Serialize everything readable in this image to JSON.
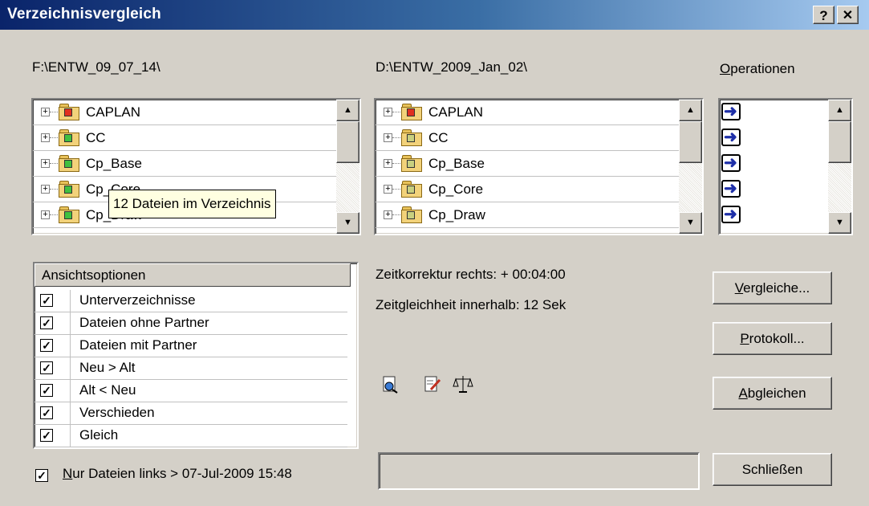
{
  "window": {
    "title": "Verzeichnisvergleich",
    "help_btn": "?",
    "close_btn": "✕"
  },
  "left": {
    "path": "F:\\ENTW_09_07_14\\",
    "items": [
      "CAPLAN",
      "CC",
      "Cp_Base",
      "Cp_Core",
      "Cp_Draw"
    ],
    "tooltip": "12 Dateien im Verzeichnis"
  },
  "right": {
    "path": "D:\\ENTW_2009_Jan_02\\",
    "items": [
      "CAPLAN",
      "CC",
      "Cp_Base",
      "Cp_Core",
      "Cp_Draw"
    ]
  },
  "operations": {
    "label": "Operationen",
    "label_accesskey": "O",
    "label_rest": "perationen",
    "count": 5
  },
  "view_options": {
    "header": "Ansichtsoptionen",
    "items": [
      {
        "label": "Unterverzeichnisse",
        "checked": true
      },
      {
        "label": "Dateien ohne Partner",
        "checked": true
      },
      {
        "label": "Dateien mit Partner",
        "checked": true
      },
      {
        "label": "Neu > Alt",
        "checked": true
      },
      {
        "label": "Alt < Neu",
        "checked": true
      },
      {
        "label": "Verschieden",
        "checked": true
      },
      {
        "label": "Gleich",
        "checked": true
      }
    ]
  },
  "filter": {
    "accesskey": "N",
    "label_rest": "ur Dateien links > 07-Jul-2009 15:48",
    "checked": true
  },
  "info": {
    "time_correction": "Zeitkorrektur rechts: + 00:04:00",
    "time_tolerance": "Zeitgleichheit innerhalb: 12 Sek"
  },
  "buttons": {
    "compare_key": "V",
    "compare_rest": "ergleiche...",
    "log_key": "P",
    "log_rest": "rotokoll...",
    "sync_key": "A",
    "sync_rest": "bgleichen",
    "close": "Schließen"
  },
  "colors": {
    "title_start": "#0a246a",
    "title_end": "#a6caf0",
    "arrow": "#1e2fa8",
    "tooltip": "#ffffe1"
  },
  "icons": {
    "caplan": "folder-red-unequal-icon",
    "left_other": "folder-green-icon",
    "right_other": "folder-check-icon",
    "op": "arrow-right-icon",
    "tools": [
      "search-doc-icon",
      "edit-doc-icon",
      "scales-icon"
    ]
  }
}
